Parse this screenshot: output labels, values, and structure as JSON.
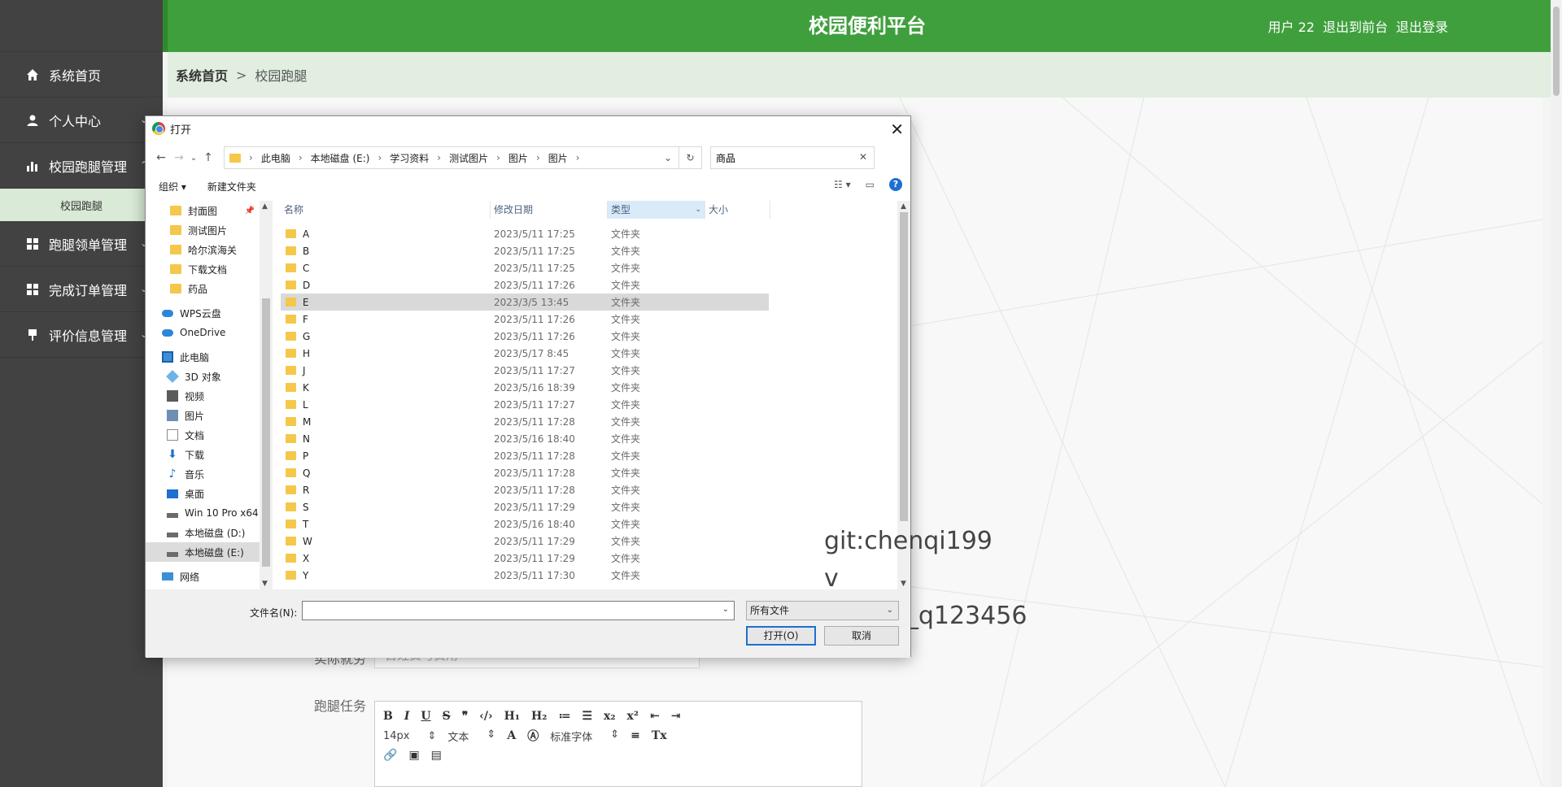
{
  "app": {
    "title": "校园便利平台",
    "user": "用户 22",
    "to_front": "退出到前台",
    "logout": "退出登录",
    "accent": "#3f9f3d"
  },
  "sidebar": {
    "items": [
      {
        "label": "系统首页",
        "icon": "home-icon"
      },
      {
        "label": "个人中心",
        "icon": "user-icon"
      },
      {
        "label": "校园跑腿管理",
        "icon": "bar-chart-icon"
      },
      {
        "label": "跑腿领单管理",
        "icon": "grid-icon"
      },
      {
        "label": "完成订单管理",
        "icon": "grid-icon"
      },
      {
        "label": "评价信息管理",
        "icon": "pin-icon"
      }
    ],
    "sub_item": "校园跑腿"
  },
  "breadcrumb": {
    "home": "系统首页",
    "sep": ">",
    "current": "校园跑腿"
  },
  "form": {
    "fee_label": "实际就劳",
    "fee_placeholder": "百姓费与费用",
    "task_label": "跑腿任务",
    "editor": {
      "font_size": "14px",
      "block": "文本",
      "font": "标准字体"
    }
  },
  "dialog": {
    "title": "打开",
    "path": [
      "此电脑",
      "本地磁盘 (E:)",
      "学习资料",
      "测试图片",
      "图片",
      "图片"
    ],
    "search_value": "商品",
    "organize": "组织 ▾",
    "new_folder": "新建文件夹",
    "tree": [
      {
        "label": "封面图",
        "icon": "folder-icon",
        "pinned": true
      },
      {
        "label": "测试图片",
        "icon": "folder-icon"
      },
      {
        "label": "哈尔滨海关",
        "icon": "folder-icon"
      },
      {
        "label": "下载文档",
        "icon": "folder-icon"
      },
      {
        "label": "药品",
        "icon": "folder-icon"
      },
      {
        "label": "WPS云盘",
        "icon": "cloud-icon"
      },
      {
        "label": "OneDrive",
        "icon": "cloud-icon"
      },
      {
        "label": "此电脑",
        "icon": "pc-icon"
      },
      {
        "label": "3D 对象",
        "icon": "3d-object-icon"
      },
      {
        "label": "视频",
        "icon": "video-icon"
      },
      {
        "label": "图片",
        "icon": "pictures-icon"
      },
      {
        "label": "文档",
        "icon": "documents-icon"
      },
      {
        "label": "下载",
        "icon": "download-icon"
      },
      {
        "label": "音乐",
        "icon": "music-icon"
      },
      {
        "label": "桌面",
        "icon": "desktop-icon"
      },
      {
        "label": "Win 10 Pro x64",
        "icon": "drive-icon"
      },
      {
        "label": "本地磁盘 (D:)",
        "icon": "drive-icon"
      },
      {
        "label": "本地磁盘 (E:)",
        "icon": "drive-icon",
        "selected": true
      },
      {
        "label": "网络",
        "icon": "network-icon"
      }
    ],
    "columns": {
      "name": "名称",
      "date": "修改日期",
      "type": "类型",
      "size": "大小"
    },
    "rows": [
      {
        "name": "A",
        "date": "2023/5/11 17:25",
        "type": "文件夹"
      },
      {
        "name": "B",
        "date": "2023/5/11 17:25",
        "type": "文件夹"
      },
      {
        "name": "C",
        "date": "2023/5/11 17:25",
        "type": "文件夹"
      },
      {
        "name": "D",
        "date": "2023/5/11 17:26",
        "type": "文件夹"
      },
      {
        "name": "E",
        "date": "2023/3/5 13:45",
        "type": "文件夹",
        "selected": true
      },
      {
        "name": "F",
        "date": "2023/5/11 17:26",
        "type": "文件夹"
      },
      {
        "name": "G",
        "date": "2023/5/11 17:26",
        "type": "文件夹"
      },
      {
        "name": "H",
        "date": "2023/5/17 8:45",
        "type": "文件夹"
      },
      {
        "name": "J",
        "date": "2023/5/11 17:27",
        "type": "文件夹"
      },
      {
        "name": "K",
        "date": "2023/5/16 18:39",
        "type": "文件夹"
      },
      {
        "name": "L",
        "date": "2023/5/11 17:27",
        "type": "文件夹"
      },
      {
        "name": "M",
        "date": "2023/5/11 17:28",
        "type": "文件夹"
      },
      {
        "name": "N",
        "date": "2023/5/16 18:40",
        "type": "文件夹"
      },
      {
        "name": "P",
        "date": "2023/5/11 17:28",
        "type": "文件夹"
      },
      {
        "name": "Q",
        "date": "2023/5/11 17:28",
        "type": "文件夹"
      },
      {
        "name": "R",
        "date": "2023/5/11 17:28",
        "type": "文件夹"
      },
      {
        "name": "S",
        "date": "2023/5/11 17:29",
        "type": "文件夹"
      },
      {
        "name": "T",
        "date": "2023/5/16 18:40",
        "type": "文件夹"
      },
      {
        "name": "W",
        "date": "2023/5/11 17:29",
        "type": "文件夹"
      },
      {
        "name": "X",
        "date": "2023/5/11 17:29",
        "type": "文件夹"
      },
      {
        "name": "Y",
        "date": "2023/5/11 17:30",
        "type": "文件夹"
      }
    ],
    "filename_label": "文件名(N):",
    "filename_value": "",
    "filetype": "所有文件",
    "open_button": "打开(O)",
    "cancel_button": "取消"
  },
  "watermark": {
    "line1": "git:chenqi199",
    "line2": "v x:chen_q123456"
  }
}
